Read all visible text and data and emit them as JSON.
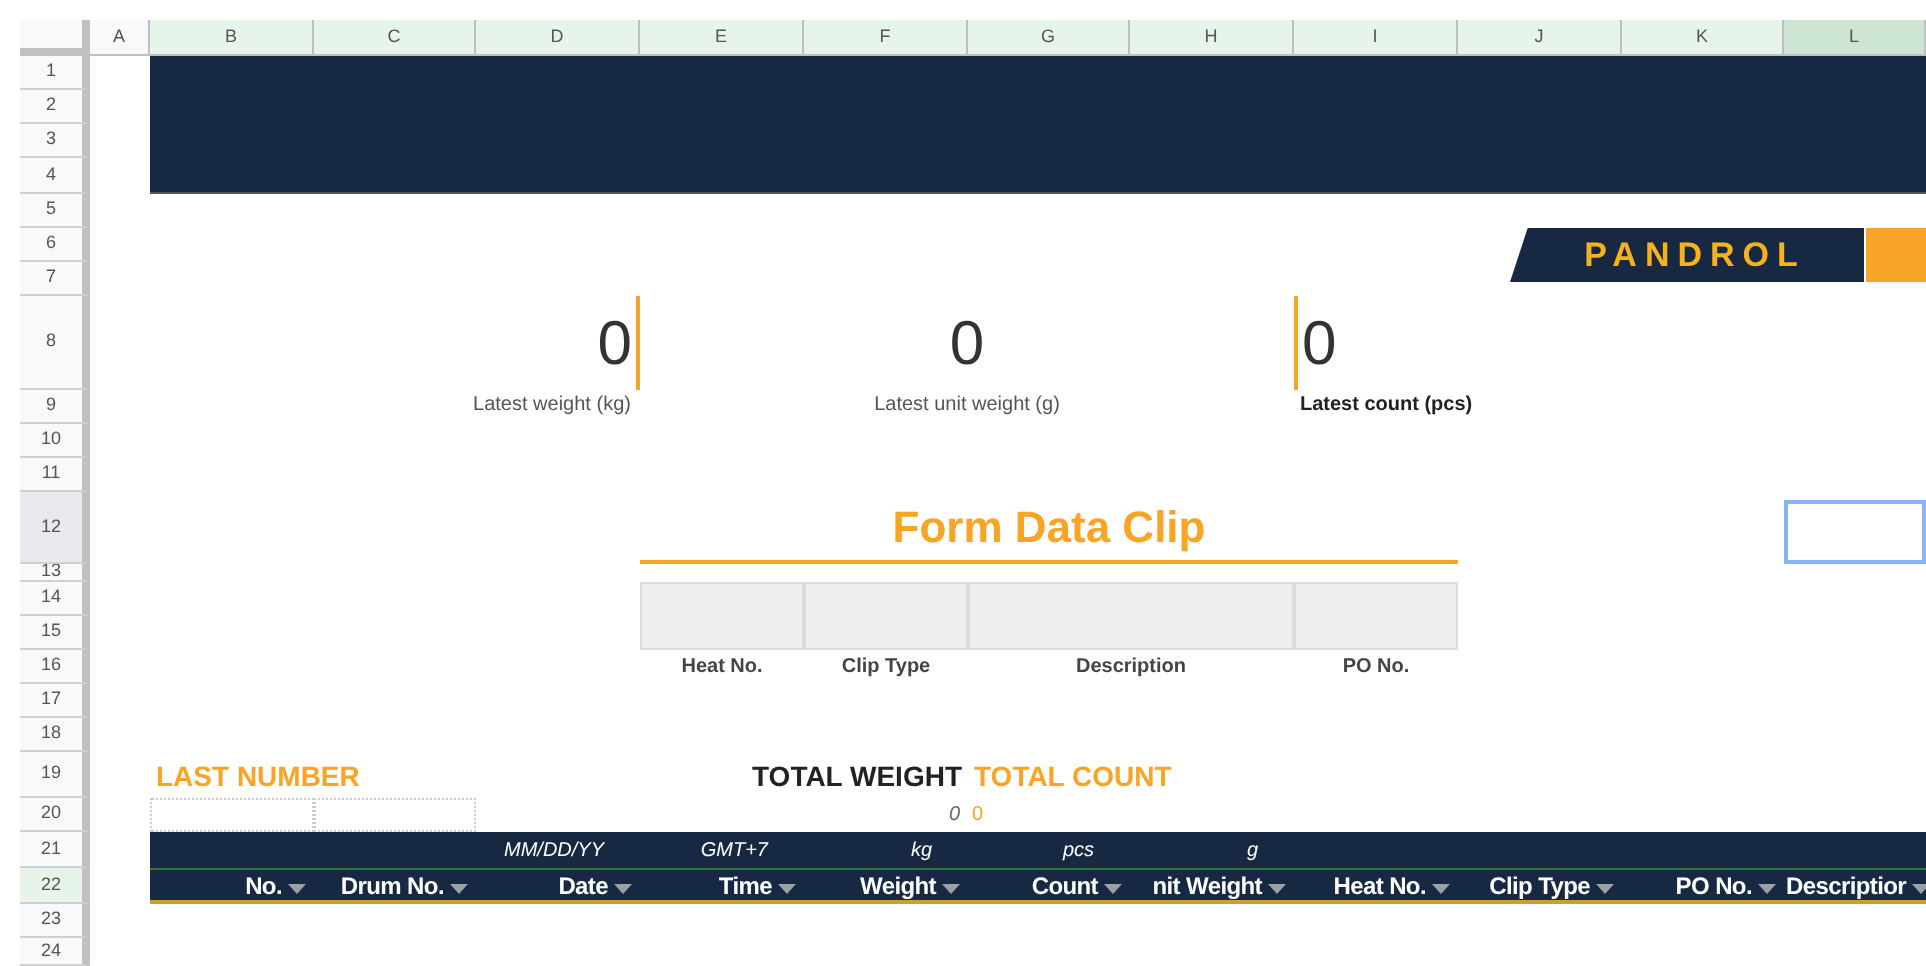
{
  "column_headers": [
    {
      "label": "A",
      "selected": false,
      "active": false
    },
    {
      "label": "B",
      "selected": true,
      "active": false
    },
    {
      "label": "C",
      "selected": true,
      "active": false
    },
    {
      "label": "D",
      "selected": true,
      "active": false
    },
    {
      "label": "E",
      "selected": true,
      "active": false
    },
    {
      "label": "F",
      "selected": true,
      "active": false
    },
    {
      "label": "G",
      "selected": true,
      "active": false
    },
    {
      "label": "H",
      "selected": true,
      "active": false
    },
    {
      "label": "I",
      "selected": true,
      "active": false
    },
    {
      "label": "J",
      "selected": true,
      "active": false
    },
    {
      "label": "K",
      "selected": true,
      "active": false
    },
    {
      "label": "L",
      "selected": true,
      "active": true
    }
  ],
  "row_headers": [
    {
      "label": "1",
      "selected": false,
      "active": false
    },
    {
      "label": "2",
      "selected": false,
      "active": false
    },
    {
      "label": "3",
      "selected": false,
      "active": false
    },
    {
      "label": "4",
      "selected": false,
      "active": false
    },
    {
      "label": "5",
      "selected": false,
      "active": false
    },
    {
      "label": "6",
      "selected": false,
      "active": false
    },
    {
      "label": "7",
      "selected": false,
      "active": false
    },
    {
      "label": "8",
      "selected": false,
      "active": false
    },
    {
      "label": "9",
      "selected": false,
      "active": false
    },
    {
      "label": "10",
      "selected": false,
      "active": false
    },
    {
      "label": "11",
      "selected": false,
      "active": false
    },
    {
      "label": "12",
      "selected": false,
      "active": true
    },
    {
      "label": "13",
      "selected": false,
      "active": false
    },
    {
      "label": "14",
      "selected": false,
      "active": false
    },
    {
      "label": "15",
      "selected": false,
      "active": false
    },
    {
      "label": "16",
      "selected": false,
      "active": false
    },
    {
      "label": "17",
      "selected": false,
      "active": false
    },
    {
      "label": "18",
      "selected": false,
      "active": false
    },
    {
      "label": "19",
      "selected": false,
      "active": false
    },
    {
      "label": "20",
      "selected": false,
      "active": false
    },
    {
      "label": "21",
      "selected": false,
      "active": false
    },
    {
      "label": "22",
      "selected": true,
      "active": false
    },
    {
      "label": "23",
      "selected": false,
      "active": false
    },
    {
      "label": "24",
      "selected": false,
      "active": false
    }
  ],
  "logo": {
    "text": "PANDROL"
  },
  "metrics": [
    {
      "value": "0",
      "label": "Latest weight (kg)",
      "accent_left": false,
      "accent_right": true
    },
    {
      "value": "0",
      "label": "Latest unit weight (g)",
      "accent_left": false,
      "accent_right": false
    },
    {
      "value": "0",
      "label": "Latest count (pcs)",
      "accent_left": true,
      "accent_right": false
    }
  ],
  "form": {
    "title": "Form Data Clip",
    "fields": [
      {
        "label": "Heat No."
      },
      {
        "label": "Clip Type"
      },
      {
        "label": "Description"
      },
      {
        "label": "PO No."
      }
    ]
  },
  "last_number": {
    "label": "LAST NUMBER"
  },
  "totals": [
    {
      "label": "TOTAL WEIGHT",
      "value": "0",
      "kind": "weight"
    },
    {
      "label": "TOTAL COUNT",
      "value": "0",
      "kind": "count"
    }
  ],
  "table": {
    "columns": [
      {
        "label": "No."
      },
      {
        "label": "Drum No."
      },
      {
        "label": "Date",
        "unit": "MM/DD/YY"
      },
      {
        "label": "Time",
        "unit": "GMT+7"
      },
      {
        "label": "Weight",
        "unit": "kg"
      },
      {
        "label": "Count",
        "unit": "pcs"
      },
      {
        "label": "nit Weight",
        "unit": "g"
      },
      {
        "label": "Heat No."
      },
      {
        "label": "Clip Type"
      },
      {
        "label": "PO No."
      },
      {
        "label": "Descriptior"
      }
    ]
  }
}
